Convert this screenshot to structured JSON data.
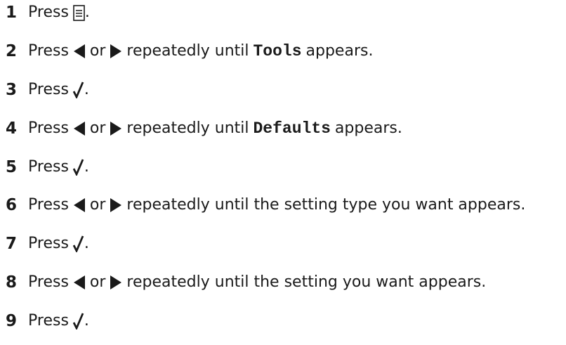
{
  "icons": {
    "menu": "menu-icon",
    "left_arrow": "left-arrow-icon",
    "right_arrow": "right-arrow-icon",
    "select": "checkmark-select-icon"
  },
  "steps": [
    {
      "number": "1",
      "parts": [
        "Press",
        "."
      ]
    },
    {
      "number": "2",
      "parts": [
        "Press",
        "or",
        "repeatedly until",
        "Tools",
        "appears."
      ]
    },
    {
      "number": "3",
      "parts": [
        "Press",
        "."
      ]
    },
    {
      "number": "4",
      "parts": [
        "Press",
        "or",
        "repeatedly until",
        "Defaults",
        "appears."
      ]
    },
    {
      "number": "5",
      "parts": [
        "Press",
        "."
      ]
    },
    {
      "number": "6",
      "parts": [
        "Press",
        "or",
        "repeatedly until the setting type you want appears."
      ]
    },
    {
      "number": "7",
      "parts": [
        "Press",
        "."
      ]
    },
    {
      "number": "8",
      "parts": [
        "Press",
        "or",
        "repeatedly until the setting you want appears."
      ]
    },
    {
      "number": "9",
      "parts": [
        "Press",
        "."
      ]
    }
  ]
}
